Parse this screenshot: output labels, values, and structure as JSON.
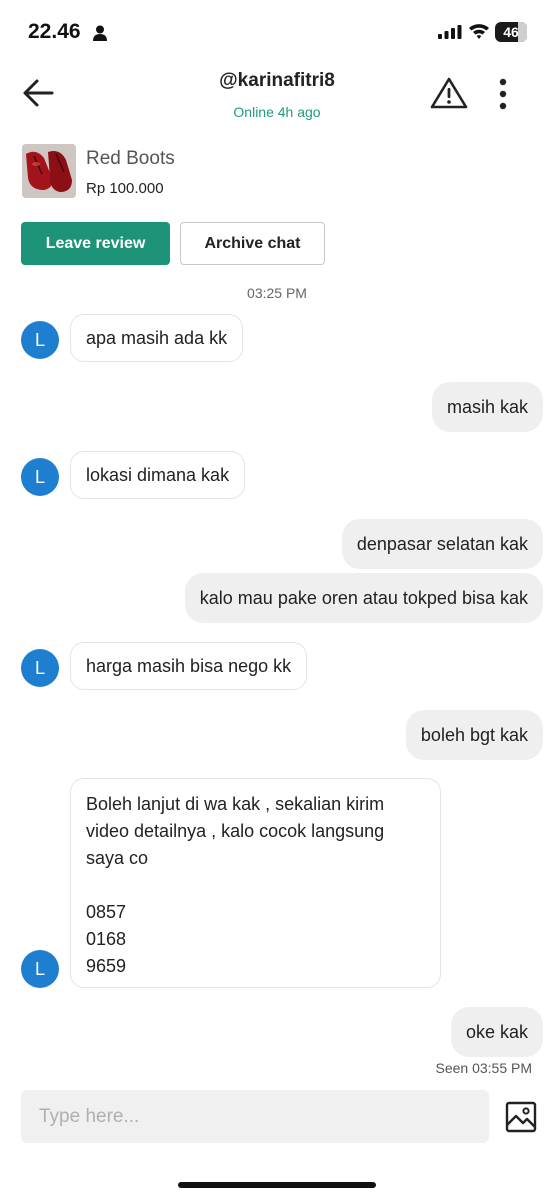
{
  "status_bar": {
    "time": "22.46",
    "battery": "46"
  },
  "header": {
    "username": "@karinafitri8",
    "status": "Online 4h ago"
  },
  "product": {
    "name": "Red Boots",
    "price": "Rp 100.000"
  },
  "actions": {
    "leave_review": "Leave review",
    "archive_chat": "Archive chat"
  },
  "chat": {
    "timestamp": "03:25 PM",
    "avatar_letter": "L",
    "messages": [
      {
        "from": "them",
        "text": "apa masih ada kk"
      },
      {
        "from": "me",
        "text": "masih kak"
      },
      {
        "from": "them",
        "text": "lokasi dimana kak"
      },
      {
        "from": "me",
        "text": "denpasar selatan kak"
      },
      {
        "from": "me",
        "text": "kalo mau pake oren atau tokped bisa kak"
      },
      {
        "from": "them",
        "text": "harga masih bisa nego kk"
      },
      {
        "from": "me",
        "text": "boleh bgt kak"
      },
      {
        "from": "them",
        "lines": [
          "Boleh lanjut di wa kak , sekalian kirim",
          "video detailnya , kalo cocok langsung",
          "saya co",
          "",
          "0857",
          "0168",
          "9659"
        ]
      },
      {
        "from": "me",
        "text": "oke kak"
      }
    ],
    "seen": "Seen 03:55 PM"
  },
  "composer": {
    "placeholder": "Type here..."
  },
  "colors": {
    "accent": "#1d9378",
    "avatar": "#1e7fd0",
    "online": "#1f9a80"
  }
}
